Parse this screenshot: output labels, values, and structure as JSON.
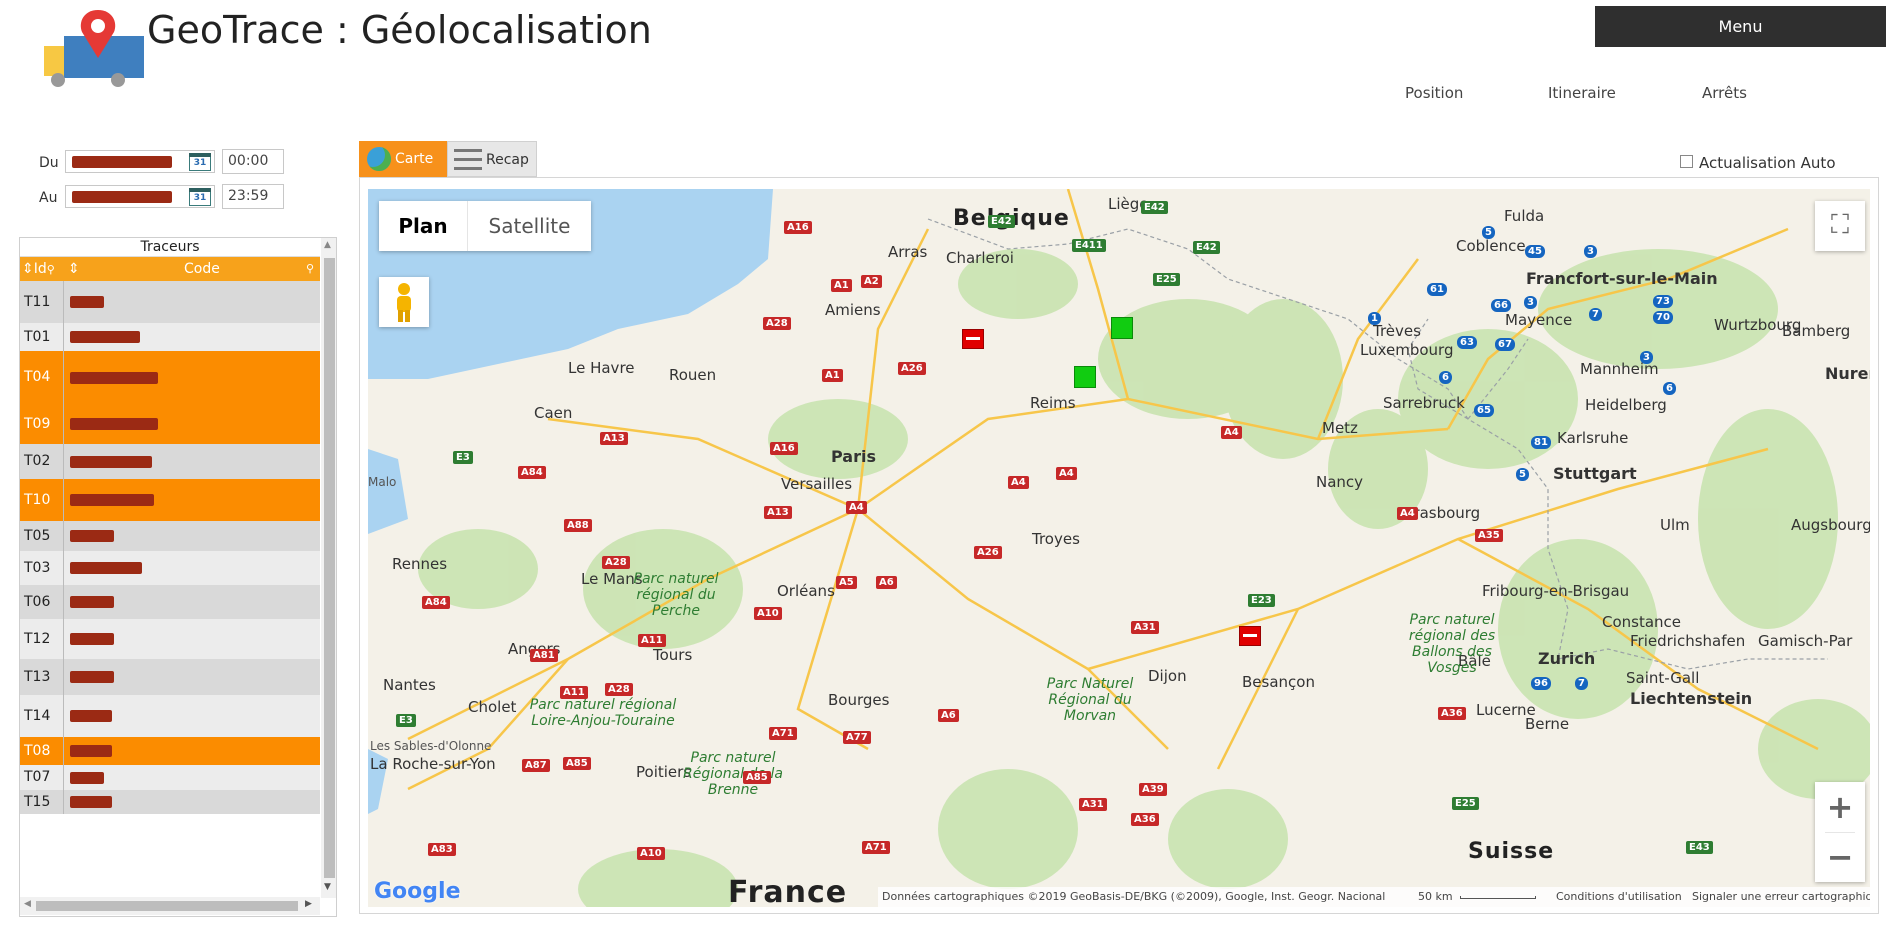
{
  "app": {
    "title": "GeoTrace : Géolocalisation"
  },
  "header": {
    "menu_label": "Menu",
    "nav": [
      "Position",
      "Itineraire",
      "Arrêts"
    ]
  },
  "filters": {
    "from_label": "Du",
    "from_time": "00:00",
    "to_label": "Au",
    "to_time": "23:59",
    "calendar_text": "31"
  },
  "trackers": {
    "title": "Traceurs",
    "col_id": "Id",
    "col_code": "Code",
    "rows": [
      {
        "id": "T11",
        "selected": false
      },
      {
        "id": "T01",
        "selected": false
      },
      {
        "id": "T04",
        "selected": true
      },
      {
        "id": "T09",
        "selected": true
      },
      {
        "id": "T02",
        "selected": false
      },
      {
        "id": "T10",
        "selected": true
      },
      {
        "id": "T05",
        "selected": false
      },
      {
        "id": "T03",
        "selected": false
      },
      {
        "id": "T06",
        "selected": false
      },
      {
        "id": "T12",
        "selected": false
      },
      {
        "id": "T13",
        "selected": false
      },
      {
        "id": "T14",
        "selected": false
      },
      {
        "id": "T08",
        "selected": true
      },
      {
        "id": "T07",
        "selected": false
      },
      {
        "id": "T15",
        "selected": false
      }
    ]
  },
  "tabs": {
    "carte": "Carte",
    "recap": "Recap"
  },
  "auto_refresh_label": "Actualisation Auto",
  "map": {
    "plan": "Plan",
    "satellite": "Satellite",
    "zoom_in": "+",
    "zoom_out": "−",
    "attribution": "Données cartographiques ©2019 GeoBasis-DE/BKG (©2009), Google, Inst. Geogr. Nacional",
    "scale": "50 km",
    "terms": "Conditions d'utilisation",
    "report": "Signaler une erreur cartographique",
    "google": "Google",
    "country_france": "France",
    "country_belgique": "Belgique",
    "country_suisse": "Suisse",
    "cities": [
      "Liège",
      "Fulda",
      "Coblence",
      "Francfort-sur-le-Main",
      "Charleroi",
      "Arras",
      "Amiens",
      "Trèves",
      "Mayence",
      "Wurtzbourg",
      "Bamberg",
      "Luxembourg",
      "Mannheim",
      "Nuremb",
      "Le Havre",
      "Rouen",
      "Reims",
      "Sarrebruck",
      "Heidelberg",
      "Caen",
      "Metz",
      "Karlsruhe",
      "Paris",
      "Versailles",
      "Nancy",
      "Stuttgart",
      "Strasbourg",
      "Ulm",
      "Augsbourg",
      "Rennes",
      "Troyes",
      "Le Mans",
      "Orléans",
      "Fribourg-en-Brisgau",
      "Constance",
      "Friedrichshafen",
      "Gamisch-Par",
      "Angers",
      "Tours",
      "Bâle",
      "Zurich",
      "Saint-Gall",
      "Liechtenstein",
      "Nantes",
      "Cholet",
      "Dijon",
      "Besançon",
      "Bourges",
      "Lucerne",
      "Berne",
      "Poitiers",
      "La Roche-sur-Yon",
      "Les Sables-d'Olonne",
      "Malo"
    ],
    "parks": [
      "Parc naturel régional du Perche",
      "Parc naturel régional des Ballons des Vosges",
      "Parc naturel régional Loire-Anjou-Touraine",
      "Parc Naturel Régional du Morvan",
      "Parc naturel Régional de la Brenne"
    ]
  }
}
